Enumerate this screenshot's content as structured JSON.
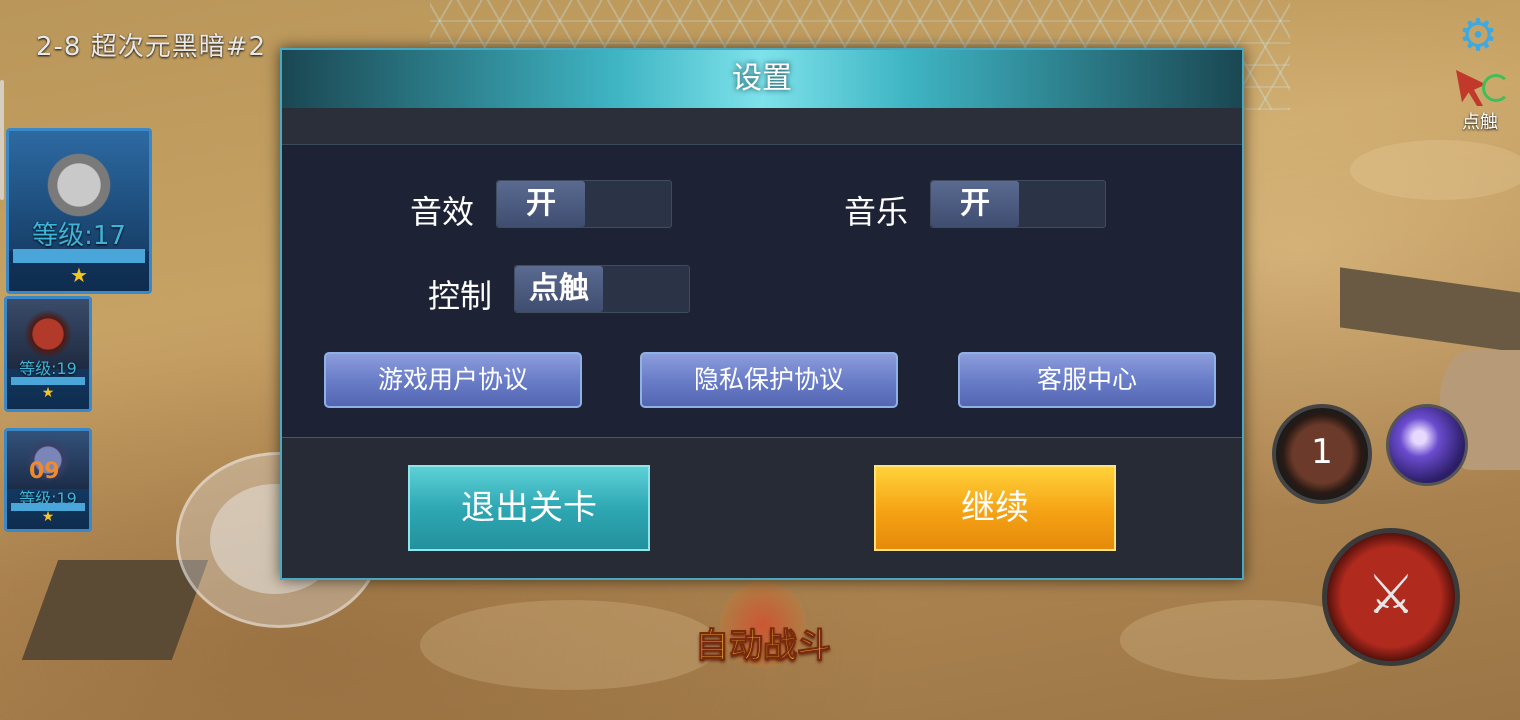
{
  "stage": {
    "label": "2-8 超次元黑暗#2"
  },
  "team": [
    {
      "level": "等级:17",
      "stars": "★"
    },
    {
      "level": "等级:19",
      "stars": "★"
    },
    {
      "level": "等级:19",
      "stars": "★",
      "badge": "09"
    }
  ],
  "top_right": {
    "settings_icon": "gear-icon",
    "touch_label": "点触"
  },
  "skills": {
    "skill_1_count": "1"
  },
  "auto_battle": {
    "label": "自动战斗"
  },
  "dialog": {
    "title": "设置",
    "sound_label": "音效",
    "sound_value": "开",
    "music_label": "音乐",
    "music_value": "开",
    "control_label": "控制",
    "control_value": "点触",
    "links": [
      "游戏用户协议",
      "隐私保护协议",
      "客服中心"
    ],
    "exit_label": "退出关卡",
    "continue_label": "继续"
  },
  "colors": {
    "accent": "#4aa9c0",
    "continue": "#f5a214",
    "exit": "#2ea8b4"
  }
}
